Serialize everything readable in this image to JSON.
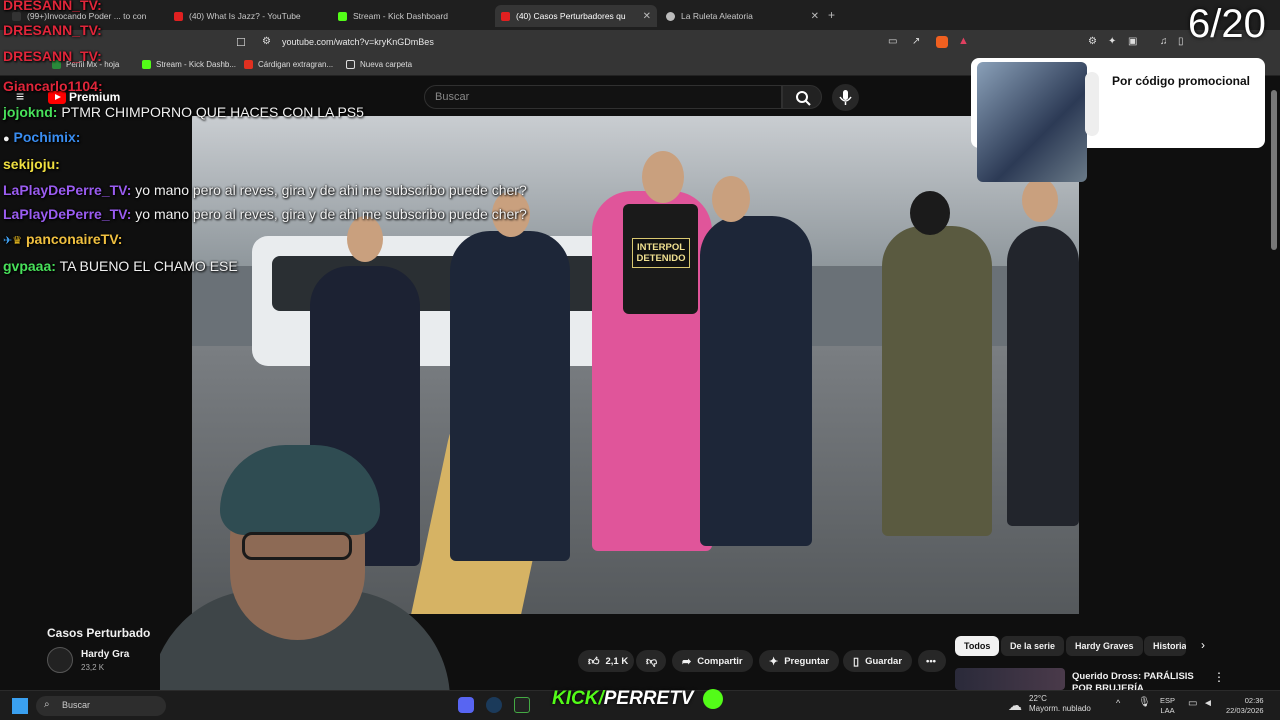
{
  "browser": {
    "tabs": [
      {
        "label": "(99+)Invocando Poder ... to con"
      },
      {
        "label": "(40) What Is Jazz? - YouTube"
      },
      {
        "label": "Stream - Kick Dashboard"
      },
      {
        "label": "(40) Casos Perturbadores qu"
      },
      {
        "label": "La Ruleta Aleatoria"
      }
    ],
    "url": "youtube.com/watch?v=kryKnGDmBes",
    "bookmarks": [
      {
        "label": "Perfil Mx - hoja"
      },
      {
        "label": "Stream - Kick Dashb..."
      },
      {
        "label": "Cárdigan extragran..."
      },
      {
        "label": "Nueva carpeta"
      }
    ]
  },
  "youtube": {
    "logo_label": "Premium",
    "search_placeholder": "Buscar",
    "video_overlay_text": "INTERPOL DETENIDO",
    "video_title": "Casos Perturbado",
    "channel_name": "Hardy Gra",
    "subscriber_count": "23,2 K",
    "actions": {
      "likes": "2,1 K",
      "share": "Compartir",
      "ask": "Preguntar",
      "save": "Guardar"
    },
    "chips": [
      "Todos",
      "De la serie",
      "Hardy Graves",
      "Historia"
    ],
    "recommendation_title": "Querido Dross: PARÁLISIS POR BRUJERÍA",
    "promo_text": "Por código promocional"
  },
  "stream_overlay": {
    "counter": "6/20",
    "chat": [
      {
        "user": "DRESANN_TV:",
        "message": "",
        "color": "#e0263a"
      },
      {
        "user": "DRESANN_TV:",
        "message": "",
        "color": "#e0263a"
      },
      {
        "user": "DRESANN_TV:",
        "message": "",
        "color": "#e0263a"
      },
      {
        "user": "Giancarlo1104:",
        "message": "",
        "color": "#e0263a"
      },
      {
        "user": "jojoknd:",
        "message": "PTMR CHIMPORNO QUE HACES CON LA PS5",
        "color": "#48e05a"
      },
      {
        "user": "Pochimix:",
        "message": "",
        "color": "#3a8df0"
      },
      {
        "user": "sekijoju:",
        "message": "",
        "color": "#f0e040"
      },
      {
        "user": "LaPlayDePerre_TV:",
        "message": "yo mano pero al reves, gira y de ahi me subscribo puede cher?",
        "color": "#9a5cf0"
      },
      {
        "user": "LaPlayDePerre_TV:",
        "message": "yo mano pero al reves, gira y de ahi me subscribo puede cher?",
        "color": "#9a5cf0"
      },
      {
        "user": "panconaireTV:",
        "message": "",
        "color": "#f0c040"
      },
      {
        "user": "gvpaaa:",
        "message": "TA BUENO EL CHAMO ESE",
        "color": "#48e05a"
      }
    ],
    "kick_brand": {
      "prefix": "KICK/",
      "name": "PERRETV"
    }
  },
  "taskbar": {
    "search_label": "Buscar",
    "weather_temp": "22°C",
    "weather_desc": "Mayorm. nublado",
    "lang_top": "ESP",
    "lang_bottom": "LAA",
    "time": "02:36",
    "date": "22/03/2026"
  },
  "colors": {
    "kick_green": "#53fc18",
    "youtube_red": "#ff0000"
  }
}
